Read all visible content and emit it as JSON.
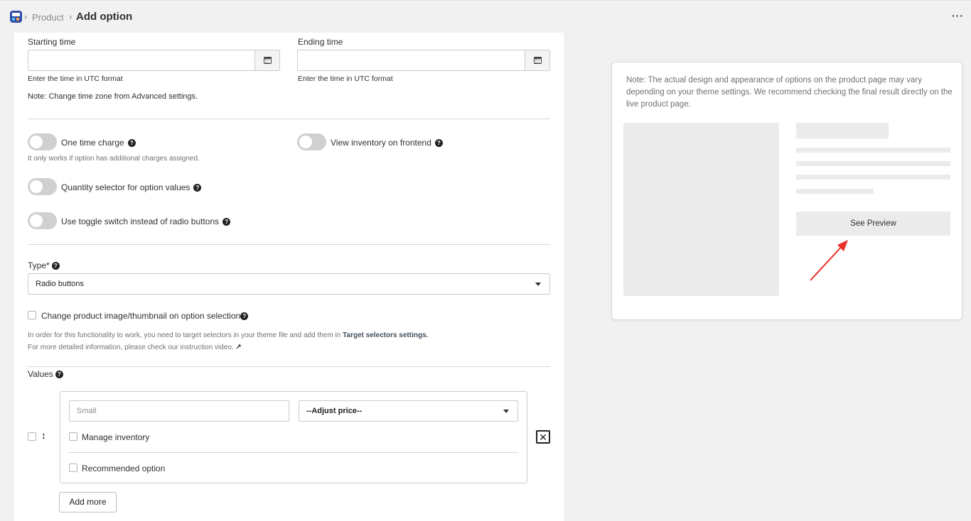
{
  "breadcrumb": {
    "parent": "Products",
    "title": "Add option"
  },
  "header": {
    "more_label": "···"
  },
  "form": {
    "starting_time": {
      "label": "Starting time",
      "value": "",
      "hint": "Enter the time in UTC format"
    },
    "ending_time": {
      "label": "Ending time",
      "value": "",
      "hint": "Enter the time in UTC format"
    },
    "timezone_note": "Note: Change time zone from Advanced settings.",
    "toggles": {
      "one_time_charge": {
        "label": "One time charge",
        "hint": "It only works if option has additional charges assigned.",
        "on": false
      },
      "view_inventory": {
        "label": "View inventory on frontend",
        "on": false
      },
      "quantity_selector": {
        "label": "Quantity selector for option values",
        "on": false
      },
      "toggle_switch": {
        "label": "Use toggle switch instead of radio buttons",
        "on": false
      }
    },
    "type": {
      "label": "Type*",
      "selected": "Radio buttons"
    },
    "change_image": {
      "label": "Change product image/thumbnail on option selection",
      "checked": false
    },
    "selector_note": {
      "prefix": "In order for this functionality to work, you need to target selectors in your theme file and add them in ",
      "link": "Target selectors settings.",
      "line2": "For more detailed information, please check our instruction video."
    },
    "values": {
      "label": "Values",
      "items": [
        {
          "placeholder": "Small",
          "value": "",
          "price": "--Adjust price--",
          "manage_inventory_label": "Manage inventory",
          "recommended_label": "Recommended option"
        }
      ],
      "add_more_label": "Add more"
    }
  },
  "preview": {
    "note": "Note: The actual design and appearance of options on the product page may vary depending on your theme settings. We recommend checking the final result directly on the live product page.",
    "button_label": "See Preview"
  },
  "colors": {
    "annotation_arrow": "#e8312a",
    "toggle_off": "#d0d0d0",
    "placeholder": "#ebebeb"
  }
}
